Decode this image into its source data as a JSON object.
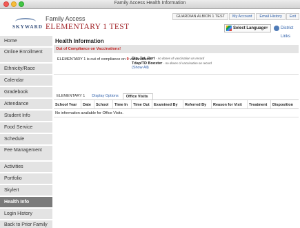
{
  "window": {
    "title": "Family Access Health Information"
  },
  "header": {
    "logo_text": "SKYWARD",
    "app_title": "Family Access",
    "student_name": "ELEMENTARY 1 TEST",
    "user_label": "GUARDIAN ALBION 1 TEST",
    "links": [
      "My Account",
      "Email History",
      "Exit"
    ],
    "language_label": "Select Language",
    "district_label": "District Links"
  },
  "sidebar": {
    "items": [
      {
        "label": "Home"
      },
      {
        "label": "Online Enrollment"
      },
      {
        "label": "Ethnicity/Race"
      },
      {
        "label": "Calendar"
      },
      {
        "label": "Gradebook"
      },
      {
        "label": "Attendance"
      },
      {
        "label": "Student Info"
      },
      {
        "label": "Food Service"
      },
      {
        "label": "Schedule"
      },
      {
        "label": "Fee Management"
      },
      {
        "label": "Activities"
      },
      {
        "label": "Portfolio"
      },
      {
        "label": "Skylert"
      },
      {
        "label": "Health Info"
      },
      {
        "label": "Login History"
      },
      {
        "label": "Back to Prior Family Access"
      }
    ],
    "active_index": 13
  },
  "main": {
    "title": "Health Information",
    "alert": {
      "heading": "Out of Compliance on Vaccinations!",
      "msg_prefix": "ELEMENTARY 1 is out of compliance on",
      "count": "9",
      "msg_suffix": "vaccinations:",
      "vaccines": [
        {
          "name": "Dip, Tet, Pert",
          "note": "- no doses of vaccination on record"
        },
        {
          "name": "Tdap/TD Booster",
          "note": "- no doses of vaccination on record"
        }
      ],
      "show_all": "(Show All)"
    },
    "tabs": [
      {
        "label": "ELEMENTARY 1"
      },
      {
        "label": "Display Options"
      },
      {
        "label": "Office Visits"
      }
    ],
    "table": {
      "columns": [
        "School Year",
        "Date",
        "School",
        "Time In",
        "Time Out",
        "Examined By",
        "Referred By",
        "Reason for Visit",
        "Treatment",
        "Disposition"
      ],
      "empty_text": "No information available for Office Visits."
    }
  }
}
